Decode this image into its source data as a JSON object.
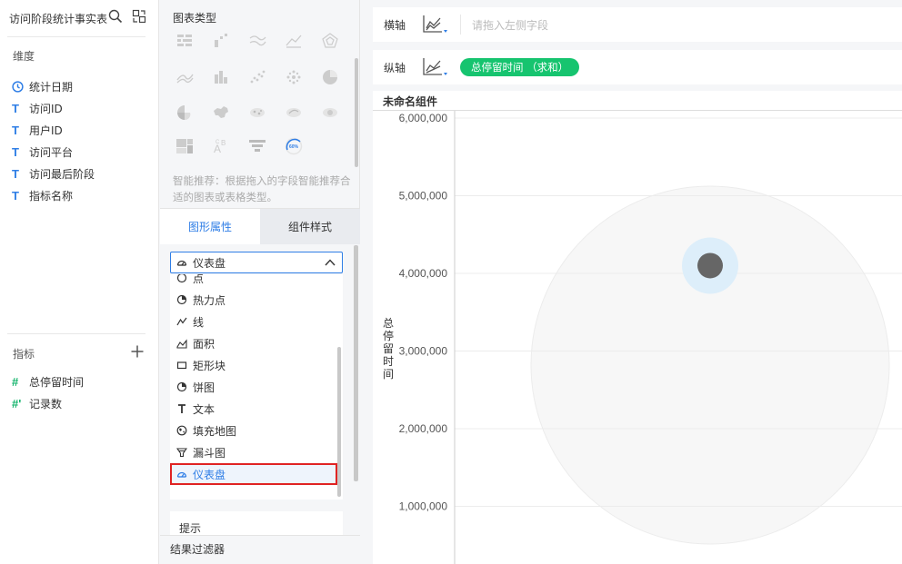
{
  "left": {
    "title": "访问阶段统计事实表",
    "dimension_label": "维度",
    "dimensions": [
      {
        "type": "date",
        "label": "统计日期"
      },
      {
        "type": "text",
        "label": "访问ID"
      },
      {
        "type": "text",
        "label": "用户ID"
      },
      {
        "type": "text",
        "label": "访问平台"
      },
      {
        "type": "text",
        "label": "访问最后阶段"
      },
      {
        "type": "text",
        "label": "指标名称"
      }
    ],
    "measure_label": "指标",
    "measures": [
      {
        "type": "#",
        "label": "总停留时间"
      },
      {
        "type": "#'",
        "label": "记录数"
      }
    ]
  },
  "middle": {
    "chart_type_title": "图表类型",
    "hint": "智能推荐：根据拖入的字段智能推荐合适的图表或表格类型。",
    "tabs": [
      {
        "label": "图形属性",
        "active": true
      },
      {
        "label": "组件样式",
        "active": false
      }
    ],
    "selected_shape": "仪表盘",
    "dropdown_items": [
      {
        "icon": "circle-icon",
        "label": "点"
      },
      {
        "icon": "heat-point-icon",
        "label": "热力点"
      },
      {
        "icon": "line-icon",
        "label": "线"
      },
      {
        "icon": "area-icon",
        "label": "面积"
      },
      {
        "icon": "rect-icon",
        "label": "矩形块"
      },
      {
        "icon": "pie-icon",
        "label": "饼图"
      },
      {
        "icon": "text-icon",
        "label": "文本"
      },
      {
        "icon": "fill-map-icon",
        "label": "填充地图"
      },
      {
        "icon": "funnel-icon",
        "label": "漏斗图"
      },
      {
        "icon": "gauge-icon",
        "label": "仪表盘"
      }
    ],
    "tip_section": "提示",
    "filter_label": "结果过滤器"
  },
  "canvas": {
    "x_axis_label": "横轴",
    "x_axis_placeholder": "请拖入左侧字段",
    "y_axis_label": "纵轴",
    "y_axis_field": "总停留时间 （求和）",
    "component_title": "未命名组件",
    "colors": {
      "accent": "#2f7ee6",
      "pill": "#16c46f",
      "highlight": "#e02323"
    }
  },
  "chart_data": {
    "type": "scatter",
    "ylabel": "总停留时间",
    "yticks": [
      "6,000,000",
      "5,000,000",
      "4,000,000",
      "3,000,000",
      "2,000,000",
      "1,000,000"
    ],
    "ylim": [
      0,
      6000000
    ],
    "points": [
      {
        "y": 4100000
      }
    ],
    "grid": true
  }
}
